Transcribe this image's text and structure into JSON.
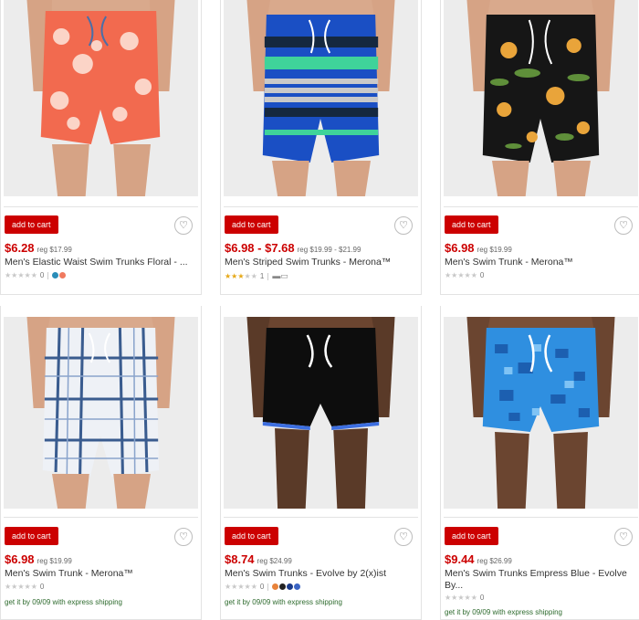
{
  "colors": {
    "brand_red": "#cc0000",
    "star": "#e6a817"
  },
  "products": [
    {
      "add_label": "add to cart",
      "price": "$6.28",
      "reg": "reg $17.99",
      "title": "Men's Elastic Waist Swim Trunks Floral - ...",
      "rating_count": "0",
      "stars_filled": 0,
      "swatches": [
        "#2a8db8",
        "#f07a5f"
      ]
    },
    {
      "add_label": "add to cart",
      "price": "$6.98 - $7.68",
      "reg": "reg $19.99 - $21.99",
      "title": "Men's Striped Swim Trunks - Merona™",
      "rating_count": "1",
      "stars_filled": 3,
      "swatches": []
    },
    {
      "add_label": "add to cart",
      "price": "$6.98",
      "reg": "reg $19.99",
      "title": "Men's Swim Trunk - Merona™",
      "rating_count": "0",
      "stars_filled": 0,
      "swatches": []
    },
    {
      "add_label": "add to cart",
      "price": "$6.98",
      "reg": "reg $19.99",
      "title": "Men's Swim Trunk - Merona™",
      "rating_count": "0",
      "stars_filled": 0,
      "swatches": [],
      "ship_prefix": "get it by",
      "ship_date": "09/09",
      "ship_suffix": "with express shipping"
    },
    {
      "add_label": "add to cart",
      "price": "$8.74",
      "reg": "reg $24.99",
      "title": "Men's Swim Trunks - Evolve by 2(x)ist",
      "rating_count": "0",
      "stars_filled": 0,
      "swatches": [
        "#e8823a",
        "#222222",
        "#1a3a8a",
        "#3b64c4"
      ],
      "ship_prefix": "get it by",
      "ship_date": "09/09",
      "ship_suffix": "with express shipping"
    },
    {
      "add_label": "add to cart",
      "price": "$9.44",
      "reg": "reg $26.99",
      "title": "Men's Swim Trunks Empress Blue - Evolve By...",
      "rating_count": "0",
      "stars_filled": 0,
      "swatches": [],
      "ship_prefix": "get it by",
      "ship_date": "09/09",
      "ship_suffix": "with express shipping"
    }
  ]
}
